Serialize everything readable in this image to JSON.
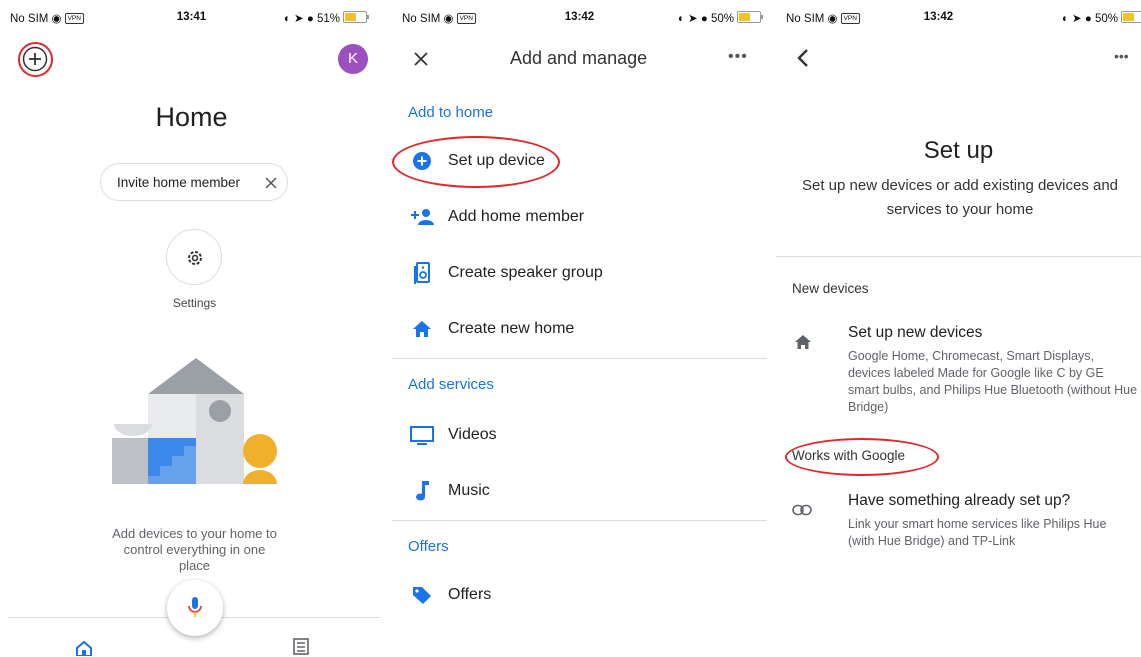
{
  "status_bars": [
    {
      "carrier": "No SIM",
      "vpn": "VPN",
      "time": "13:41",
      "battery": "51%",
      "battery_level": 0.51
    },
    {
      "carrier": "No SIM",
      "vpn": "VPN",
      "time": "13:42",
      "battery": "50%",
      "battery_level": 0.5
    },
    {
      "carrier": "No SIM",
      "vpn": "VPN",
      "time": "13:42",
      "battery": "50%",
      "battery_level": 0.5
    }
  ],
  "home": {
    "avatar_letter": "K",
    "title": "Home",
    "invite_chip": "Invite home member",
    "settings_label": "Settings",
    "empty_message": "Add devices to your home to control everything in one place"
  },
  "add_manage": {
    "title": "Add and manage",
    "add_to_home": "Add to home",
    "set_up_device": "Set up device",
    "add_home_member": "Add home member",
    "create_speaker_group": "Create speaker group",
    "create_new_home": "Create new home",
    "add_services": "Add services",
    "videos": "Videos",
    "music": "Music",
    "offers_header": "Offers",
    "offers": "Offers"
  },
  "setup": {
    "title": "Set up",
    "subtitle": "Set up new devices or add existing devices and services to your home",
    "new_devices_header": "New devices",
    "new_devices_title": "Set up new devices",
    "new_devices_desc": "Google Home, Chromecast, Smart Displays, devices labeled Made for Google like C by GE smart bulbs, and Philips Hue Bluetooth (without Hue Bridge)",
    "works_with_google": "Works with Google",
    "existing_title": "Have something already set up?",
    "existing_desc": "Link your smart home services like Philips Hue (with Hue Bridge) and TP-Link"
  },
  "colors": {
    "accent_blue": "#1a73e8",
    "highlight_red": "#e3262a",
    "avatar_purple": "#9c4fbf",
    "illustration_orange": "#f0b02c"
  },
  "icons": [
    "plus-icon",
    "close-icon",
    "settings-gear-icon",
    "mic-icon",
    "home-tab-icon",
    "feed-tab-icon",
    "add-circle-icon",
    "add-person-icon",
    "speaker-icon",
    "home-icon",
    "tv-icon",
    "music-note-icon",
    "tag-icon",
    "back-icon",
    "more-icon",
    "link-icon"
  ]
}
